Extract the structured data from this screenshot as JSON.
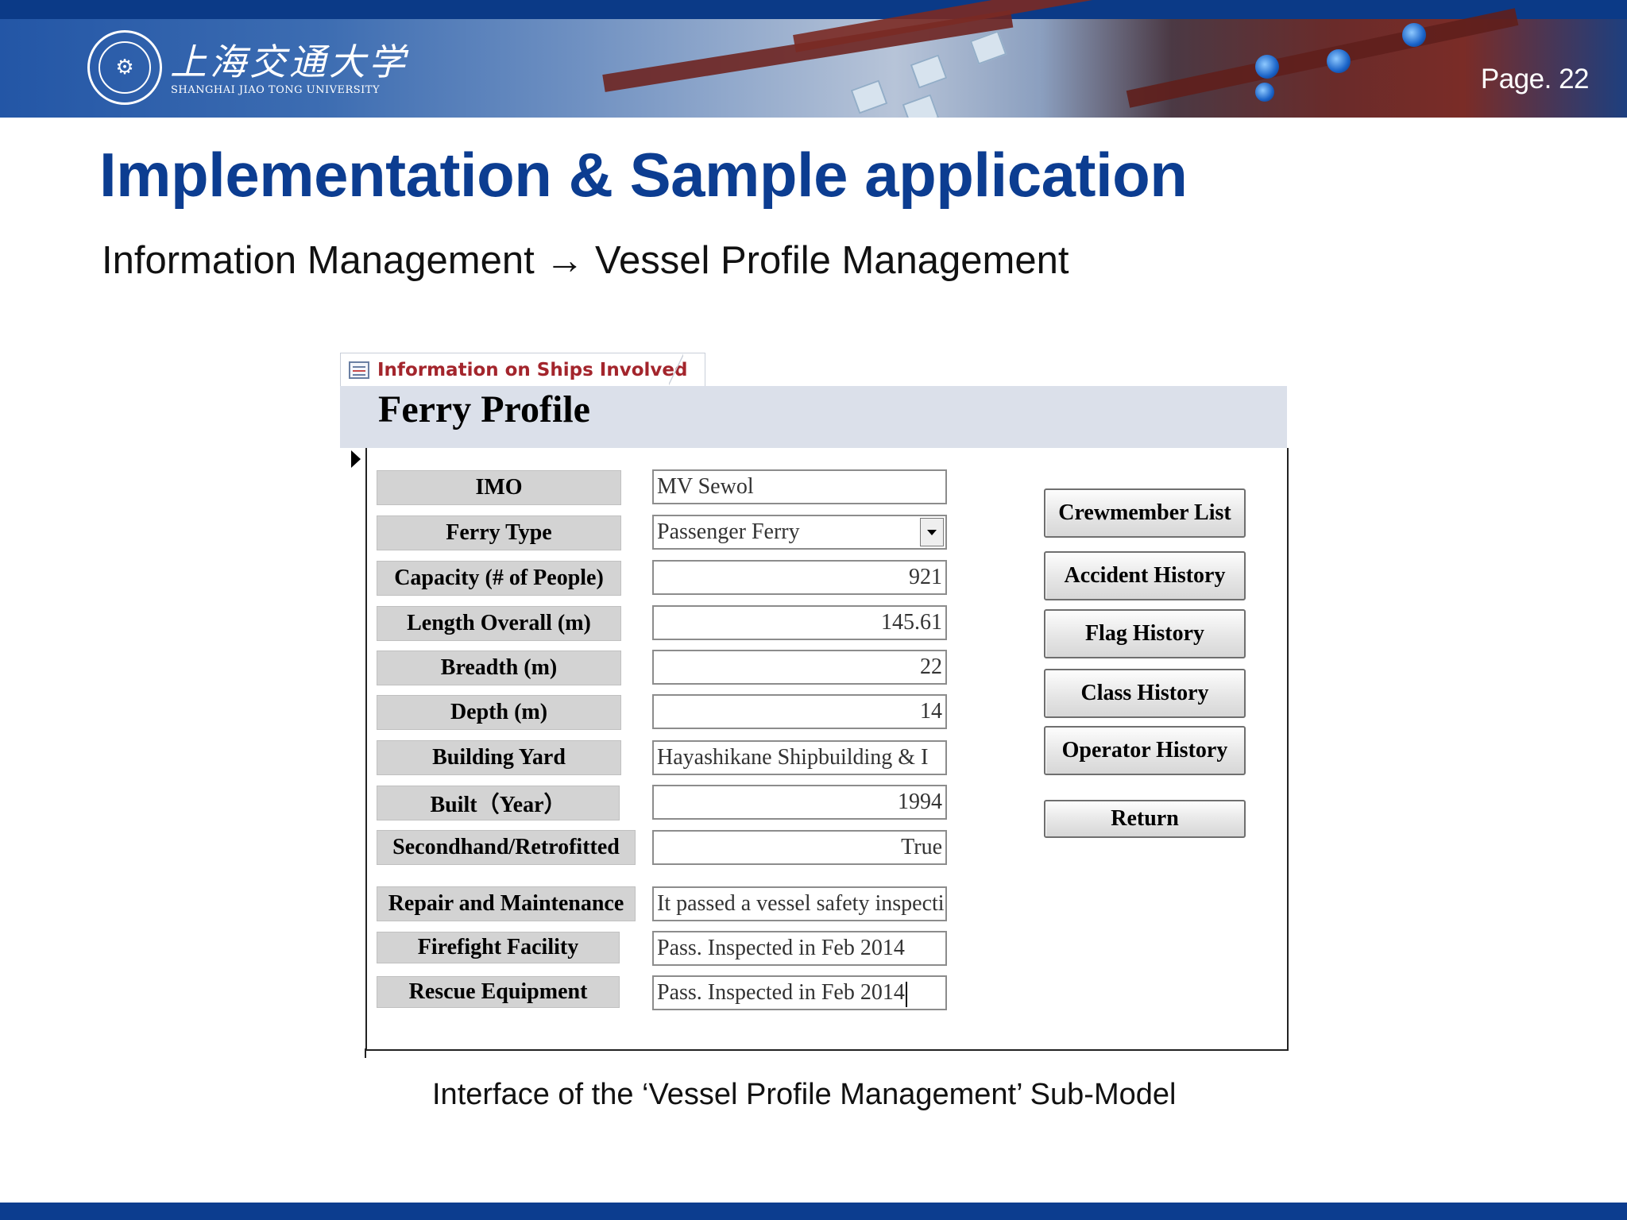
{
  "header": {
    "university_cn": "上海交通大学",
    "university_en": "SHANGHAI JIAO TONG UNIVERSITY",
    "seal_icon": "university-seal-icon",
    "page_number": "Page. 22"
  },
  "slide": {
    "title": "Implementation & Sample application",
    "subtitle": "Information Management → Vessel Profile Management",
    "caption": "Interface of the ‘Vessel Profile Management’ Sub-Model"
  },
  "form": {
    "tab_label": "Information on Ships Involved",
    "tab_icon": "form-icon",
    "title": "Ferry Profile",
    "fields": [
      {
        "label": "IMO",
        "value": "MV Sewol"
      },
      {
        "label": "Ferry Type",
        "value": "Passenger Ferry"
      },
      {
        "label": "Capacity (# of People)",
        "value": "921"
      },
      {
        "label": "Length Overall (m)",
        "value": "145.61"
      },
      {
        "label": "Breadth (m)",
        "value": "22"
      },
      {
        "label": "Depth (m)",
        "value": "14"
      },
      {
        "label": "Building Yard",
        "value": "Hayashikane Shipbuilding & I"
      },
      {
        "label": "Built（Year）",
        "value": "1994"
      },
      {
        "label": "Secondhand/Retrofitted",
        "value": "True"
      },
      {
        "label": "Repair and Maintenance",
        "value": "It passed a vessel safety inspecti"
      },
      {
        "label": "Firefight Facility",
        "value": "Pass. Inspected in Feb 2014"
      },
      {
        "label": "Rescue Equipment",
        "value": "Pass. Inspected in Feb 2014"
      }
    ],
    "buttons": {
      "crewmember_list": "Crewmember List",
      "accident_history": "Accident History",
      "flag_history": "Flag History",
      "class_history": "Class History",
      "operator_history": "Operator History",
      "return": "Return"
    }
  },
  "colors": {
    "title_blue": "#0c3d91",
    "banner_blue": "#0f3e8c",
    "tab_label_red": "#a3252c",
    "form_header_bg": "#dbe0ea",
    "label_bg": "#d3d3d3"
  }
}
